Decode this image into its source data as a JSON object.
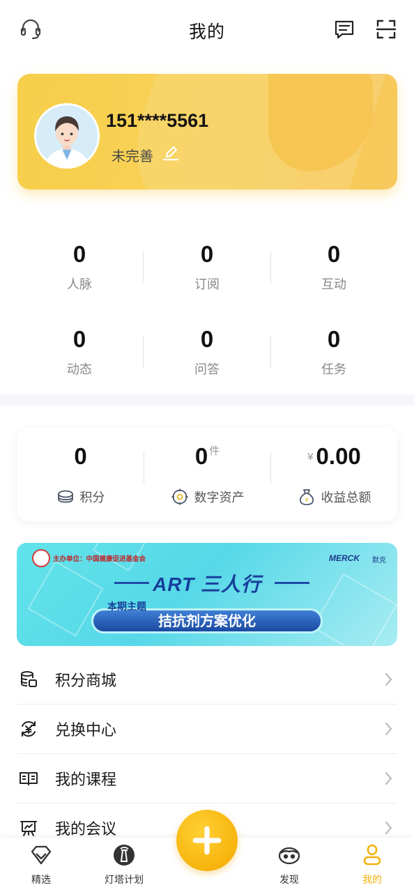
{
  "header": {
    "title": "我的",
    "left_icon": "headset-icon",
    "right_icons": [
      "message-icon",
      "scan-icon"
    ]
  },
  "profile": {
    "phone": "151****5561",
    "status": "未完善",
    "avatar": "doctor-avatar",
    "card_color": "#f6cf4a"
  },
  "stats": [
    {
      "value": "0",
      "label": "人脉"
    },
    {
      "value": "0",
      "label": "订阅"
    },
    {
      "value": "0",
      "label": "互动"
    },
    {
      "value": "0",
      "label": "动态"
    },
    {
      "value": "0",
      "label": "问答"
    },
    {
      "value": "0",
      "label": "任务"
    }
  ],
  "wallet": {
    "points": {
      "value": "0",
      "label": "积分",
      "icon": "coins-icon"
    },
    "assets": {
      "value": "0",
      "unit": "件",
      "label": "数字资产",
      "icon": "digital-asset-icon"
    },
    "earnings": {
      "currency": "¥",
      "value": "0.00",
      "label": "收益总额",
      "icon": "money-bag-icon"
    }
  },
  "banner": {
    "organizer": "主办单位：中国健康促进基金会",
    "sponsor": "MERCK",
    "sponsor_cn": "默克",
    "title": "ART 三人行",
    "tag": "本期主题",
    "topic": "拮抗剂方案优化",
    "bg_color": "#5fe0ea"
  },
  "menu": [
    {
      "label": "积分商城",
      "icon": "points-mall-icon"
    },
    {
      "label": "兑换中心",
      "icon": "exchange-icon"
    },
    {
      "label": "我的课程",
      "icon": "course-book-icon"
    },
    {
      "label": "我的会议",
      "icon": "meeting-board-icon"
    }
  ],
  "tabbar": {
    "items": [
      {
        "label": "精选",
        "icon": "diamond-icon"
      },
      {
        "label": "灯塔计划",
        "icon": "lighthouse-icon"
      },
      {
        "label": "发现",
        "icon": "discover-face-icon"
      },
      {
        "label": "我的",
        "icon": "person-icon",
        "active": true
      }
    ],
    "fab_icon": "plus-icon",
    "accent": "#f3b30e"
  }
}
